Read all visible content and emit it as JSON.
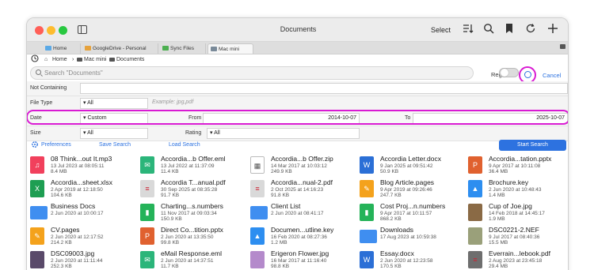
{
  "window": {
    "title": "Documents",
    "select_label": "Select"
  },
  "tabs": [
    {
      "label": "Home",
      "color": "#5aa9e6"
    },
    {
      "label": "GoogleDrive - Personal",
      "color": "#e6a23c"
    },
    {
      "label": "Sync Files",
      "color": "#4caf50"
    },
    {
      "label": "Mac mini",
      "color": "#7a8a99"
    }
  ],
  "path": [
    "Home",
    "Mac mini",
    "Documents"
  ],
  "search": {
    "placeholder": "Search \"Documents\"",
    "regex_label": "Regex",
    "cancel_label": "Cancel"
  },
  "filters": {
    "not_containing_label": "Not Containing",
    "file_type_label": "File Type",
    "file_type_value": "▾  All",
    "file_type_placeholder": "Example: jpg,pdf",
    "date_label": "Date",
    "date_value": "▾  Custom",
    "from_label": "From",
    "from_value": "2014-10-07",
    "to_label": "To",
    "to_value": "2025-10-07",
    "size_label": "Size",
    "size_value": "▾  All",
    "rating_label": "Rating",
    "rating_value": "▾  All"
  },
  "actions": {
    "preferences": "Preferences",
    "save_search": "Save Search",
    "load_search": "Load Search",
    "start_search": "Start Search"
  },
  "files": [
    {
      "name": "08 Think...out It.mp3",
      "date": "13 Jul 2023 at 08:05:11",
      "size": "8.4 MB",
      "icon": "music-icon",
      "color": "#f1405c"
    },
    {
      "name": "Accordia...b Offer.eml",
      "date": "13 Jul 2022 at 11:37:09",
      "size": "11.4 KB",
      "icon": "email-icon",
      "color": "#2bb57a"
    },
    {
      "name": "Accordia...b Offer.zip",
      "date": "14 Mar 2017 at 10:03:12",
      "size": "249.9 KB",
      "icon": "zip-icon",
      "color": "#555555"
    },
    {
      "name": "Accordia Letter.docx",
      "date": "9 Jan 2025 at 09:51:42",
      "size": "50.9 KB",
      "icon": "word-icon",
      "color": "#2b6fd6"
    },
    {
      "name": "Accordia...tation.pptx",
      "date": "9 Apr 2017 at 10:11:08",
      "size": "36.4 MB",
      "icon": "powerpoint-icon",
      "color": "#e0612f"
    },
    {
      "name": "Accordia...sheet.xlsx",
      "date": "2 Apr 2019 at 12:18:50",
      "size": "104.6 KB",
      "icon": "excel-icon",
      "color": "#1e9e52"
    },
    {
      "name": "Accordia T...anual.pdf",
      "date": "30 Sep 2025 at 08:35:28",
      "size": "91.7 KB",
      "icon": "pdf-icon",
      "color": "#d9d9d9"
    },
    {
      "name": "Accordia...nual-2.pdf",
      "date": "2 Oct 2025 at 14:16:23",
      "size": "91.8 KB",
      "icon": "pdf-icon",
      "color": "#d9d9d9"
    },
    {
      "name": "Blog Article.pages",
      "date": "9 Apr 2019 at 09:26:46",
      "size": "247.7 KB",
      "icon": "pages-icon",
      "color": "#f4a21c"
    },
    {
      "name": "Brochure.key",
      "date": "2 Jun 2020 at 10:48:43",
      "size": "1.4 MB",
      "icon": "keynote-icon",
      "color": "#2d8ef0"
    },
    {
      "name": "Business Docs",
      "date": "2 Jun 2020 at 10:00:17",
      "size": "",
      "icon": "folder-icon",
      "color": "#3f8ef0"
    },
    {
      "name": "Charting...s.numbers",
      "date": "11 Nov 2017 at 09:03:34",
      "size": "150.9 KB",
      "icon": "numbers-icon",
      "color": "#25b359"
    },
    {
      "name": "Client List",
      "date": "2 Jun 2020 at 08:41:17",
      "size": "",
      "icon": "folder-icon",
      "color": "#3f8ef0"
    },
    {
      "name": "Cost Proj...n.numbers",
      "date": "9 Apr 2017 at 10:11:57",
      "size": "868.2 KB",
      "icon": "numbers-icon",
      "color": "#25b359"
    },
    {
      "name": "Cup of Joe.jpg",
      "date": "14 Feb 2018 at 14:45:17",
      "size": "1.9 MB",
      "icon": "image-icon",
      "color": "#8a6a45"
    },
    {
      "name": "CV.pages",
      "date": "2 Jun 2020 at 12:17:52",
      "size": "214.2 KB",
      "icon": "pages-icon",
      "color": "#f4a21c"
    },
    {
      "name": "Direct Co...tition.pptx",
      "date": "2 Jun 2020 at 13:35:50",
      "size": "99.8 KB",
      "icon": "powerpoint-icon",
      "color": "#e0612f"
    },
    {
      "name": "Documen...utline.key",
      "date": "16 Feb 2020 at 08:27:36",
      "size": "1.2 MB",
      "icon": "keynote-icon",
      "color": "#2d8ef0"
    },
    {
      "name": "Downloads",
      "date": "17 Aug 2023 at 10:59:38",
      "size": "",
      "icon": "folder-icon",
      "color": "#3f8ef0"
    },
    {
      "name": "DSC0221-2.NEF",
      "date": "9 Jul 2017 at 08:40:36",
      "size": "15.5 MB",
      "icon": "image-icon",
      "color": "#9aa07a"
    },
    {
      "name": "DSC09003.jpg",
      "date": "2 Jun 2020 at 11:11:44",
      "size": "252.3 KB",
      "icon": "image-icon",
      "color": "#5a4a6a"
    },
    {
      "name": "eMail Response.eml",
      "date": "2 Jun 2020 at 14:37:51",
      "size": "11.7 KB",
      "icon": "email-icon",
      "color": "#2bb57a"
    },
    {
      "name": "Erigeron Flower.jpg",
      "date": "16 Mar 2017 at 11:16:40",
      "size": "98.8 KB",
      "icon": "image-icon",
      "color": "#b48acb"
    },
    {
      "name": "Essay.docx",
      "date": "2 Jun 2020 at 12:23:58",
      "size": "170.5 KB",
      "icon": "word-icon",
      "color": "#2b6fd6"
    },
    {
      "name": "Everrain...lebook.pdf",
      "date": "2 Aug 2023 at 23:45:18",
      "size": "29.4 MB",
      "icon": "pdf-icon",
      "color": "#6e6e6e"
    }
  ]
}
